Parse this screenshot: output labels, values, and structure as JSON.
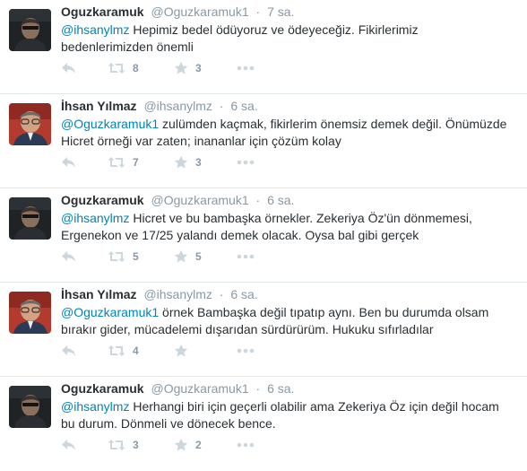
{
  "tweets": [
    {
      "author": "oguz",
      "fullname": "Oguzkaramuk",
      "username": "@Oguzkaramuk1",
      "separator": "·",
      "time": "7 sa.",
      "mention": "@ihsanylmz",
      "text": " Hepimiz bedel ödüyoruz ve ödeyeceğiz. Fikirlerimiz bedenlerimizden önemli",
      "retweets": "8",
      "favorites": "3"
    },
    {
      "author": "ihsan",
      "fullname": "İhsan Yılmaz",
      "username": "@ihsanylmz",
      "separator": "·",
      "time": "6 sa.",
      "mention": "@Oguzkaramuk1",
      "text": " zulümden kaçmak, fikirlerim önemsiz demek değil. Önümüzde Hicret örneği var zaten; inananlar için çözüm kolay",
      "retweets": "7",
      "favorites": "3"
    },
    {
      "author": "oguz",
      "fullname": "Oguzkaramuk",
      "username": "@Oguzkaramuk1",
      "separator": "·",
      "time": "6 sa.",
      "mention": "@ihsanylmz",
      "text": " Hicret ve bu bambaşka örnekler. Zekeriya Öz'ün dönmemesi, Ergenekon ve 17/25 yalandı demek olacak. Oysa bal gibi gerçek",
      "retweets": "5",
      "favorites": "5"
    },
    {
      "author": "ihsan",
      "fullname": "İhsan Yılmaz",
      "username": "@ihsanylmz",
      "separator": "·",
      "time": "6 sa.",
      "mention": "@Oguzkaramuk1",
      "text": " örnek Bambaşka değil tıpatıp aynı. Ben bu durumda olsam bırakır gider, mücadelemi dışarıdan sürdürürüm. Hukuku sıfırladılar",
      "retweets": "4",
      "favorites": ""
    },
    {
      "author": "oguz",
      "fullname": "Oguzkaramuk",
      "username": "@Oguzkaramuk1",
      "separator": "·",
      "time": "6 sa.",
      "mention": "@ihsanylmz",
      "text": " Herhangi biri için geçerli olabilir ama Zekeriya Öz için değil hocam bu durum. Dönmeli ve dönecek bence.",
      "retweets": "3",
      "favorites": "2"
    }
  ],
  "icons": {
    "reply": "reply-icon",
    "retweet": "retweet-icon",
    "favorite": "star-icon",
    "more": "more-icon"
  },
  "colors": {
    "mention": "#0084b4",
    "icon": "#ccd6dd",
    "meta": "#8899a6",
    "text": "#292f33"
  }
}
